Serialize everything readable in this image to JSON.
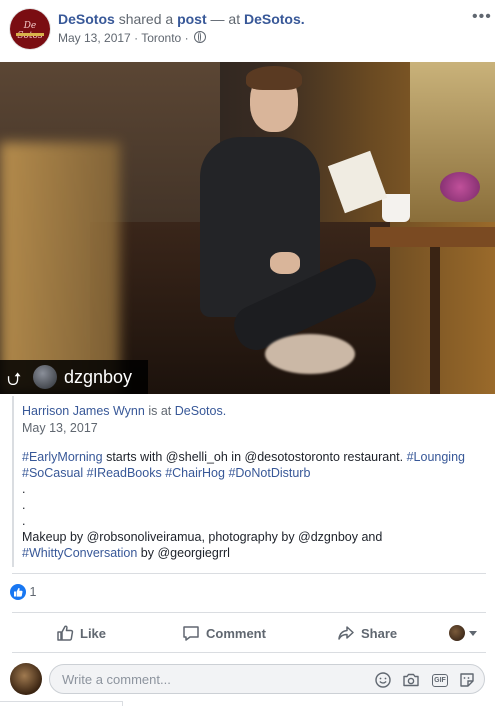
{
  "post": {
    "page_name": "DeSotos",
    "shared_text": "shared a",
    "post_link": "post",
    "at_text": "— at",
    "location": "DeSotos.",
    "date": "May 13, 2017",
    "separator": "·",
    "city": "Toronto",
    "more_label": "•••",
    "logo_text": "De Sotos"
  },
  "photo": {
    "ig_username": "dzgnboy",
    "repost_glyph": "⮍"
  },
  "quoted": {
    "author": "Harrison James Wynn",
    "is_at": "is at",
    "place": "DeSotos.",
    "date": "May 13, 2017",
    "line1_tag1": "#EarlyMorning",
    "line1_text": " starts with @shelli_oh in @desotostoronto restaurant. ",
    "line1_tag2": "#Lounging",
    "line2_tag1": "#SoCasual",
    "line2_tag2": "#IReadBooks",
    "line2_tag3": "#ChairHog",
    "line2_tag4": "#DoNotDisturb",
    "dot": ".",
    "credits_text": "Makeup by @robsonoliveiramua, photography by @dzgnboy and",
    "credits_tag": "#WhittyConversation",
    "credits_tail": " by @georgiegrrl"
  },
  "reactions": {
    "like_count": "1"
  },
  "actions": {
    "like": "Like",
    "comment": "Comment",
    "share": "Share"
  },
  "comment_box": {
    "placeholder": "Write a comment..."
  },
  "colors": {
    "link": "#385898",
    "like_blue": "#1877f2",
    "muted": "#606770"
  }
}
